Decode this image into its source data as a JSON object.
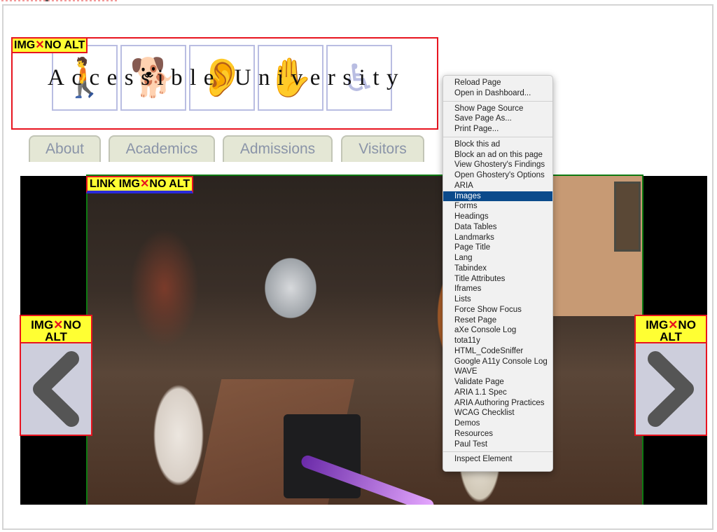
{
  "window": {
    "frame_color": "#d4d4d4"
  },
  "logo": {
    "title": "Accessible University",
    "icons": [
      "cane-icon",
      "guide-dog-icon",
      "hearing-icon",
      "sign-language-icon",
      "wheelchair-icon"
    ],
    "icon_glyphs": [
      "🚶",
      "🐕",
      "👂",
      "✋",
      "♿"
    ],
    "flag": {
      "prefix": "IMG",
      "mark": "✕",
      "suffix": "NO ALT"
    }
  },
  "nav": {
    "tabs": [
      {
        "label": "About"
      },
      {
        "label": "Academics"
      },
      {
        "label": "Admissions"
      },
      {
        "label": "Visitors"
      }
    ]
  },
  "carousel": {
    "photo_flag": {
      "prefix": "LINK IMG",
      "mark": "✕",
      "suffix": "NO ALT"
    },
    "prev_flag": {
      "prefix": "IMG",
      "mark": "✕",
      "suffix": "NO",
      "line2": "ALT"
    },
    "next_flag": {
      "prefix": "IMG",
      "mark": "✕",
      "suffix": "NO",
      "line2": "ALT"
    }
  },
  "context_menu": {
    "groups": [
      [
        "Reload Page",
        "Open in Dashboard..."
      ],
      [
        "Show Page Source",
        "Save Page As...",
        "Print Page..."
      ],
      [
        "Block this ad",
        "Block an ad on this page",
        "View Ghostery's Findings",
        "Open Ghostery's Options",
        "ARIA",
        "Images",
        "Forms",
        "Headings",
        "Data Tables",
        "Landmarks",
        "Page Title",
        "Lang",
        "Tabindex",
        "Title Attributes",
        "Iframes",
        "Lists",
        "Force Show Focus",
        "Reset Page",
        "aXe Console Log",
        "tota11y",
        "HTML_CodeSniffer",
        "Google A11y Console Log",
        "WAVE",
        "Validate Page",
        "ARIA 1.1 Spec",
        "ARIA Authoring Practices",
        "WCAG Checklist",
        "Demos",
        "Resources",
        "Paul Test"
      ],
      [
        "Inspect Element"
      ]
    ],
    "highlighted": "Images",
    "highlight_color": "#0b4a8b"
  },
  "colors": {
    "flag_bg": "#ffff33",
    "flag_border": "#e8141f",
    "link_underline": "#2a2ad8",
    "photo_border": "#0d7a12",
    "tab_bg": "#e4e7d5",
    "tab_text": "#8a94a8"
  }
}
